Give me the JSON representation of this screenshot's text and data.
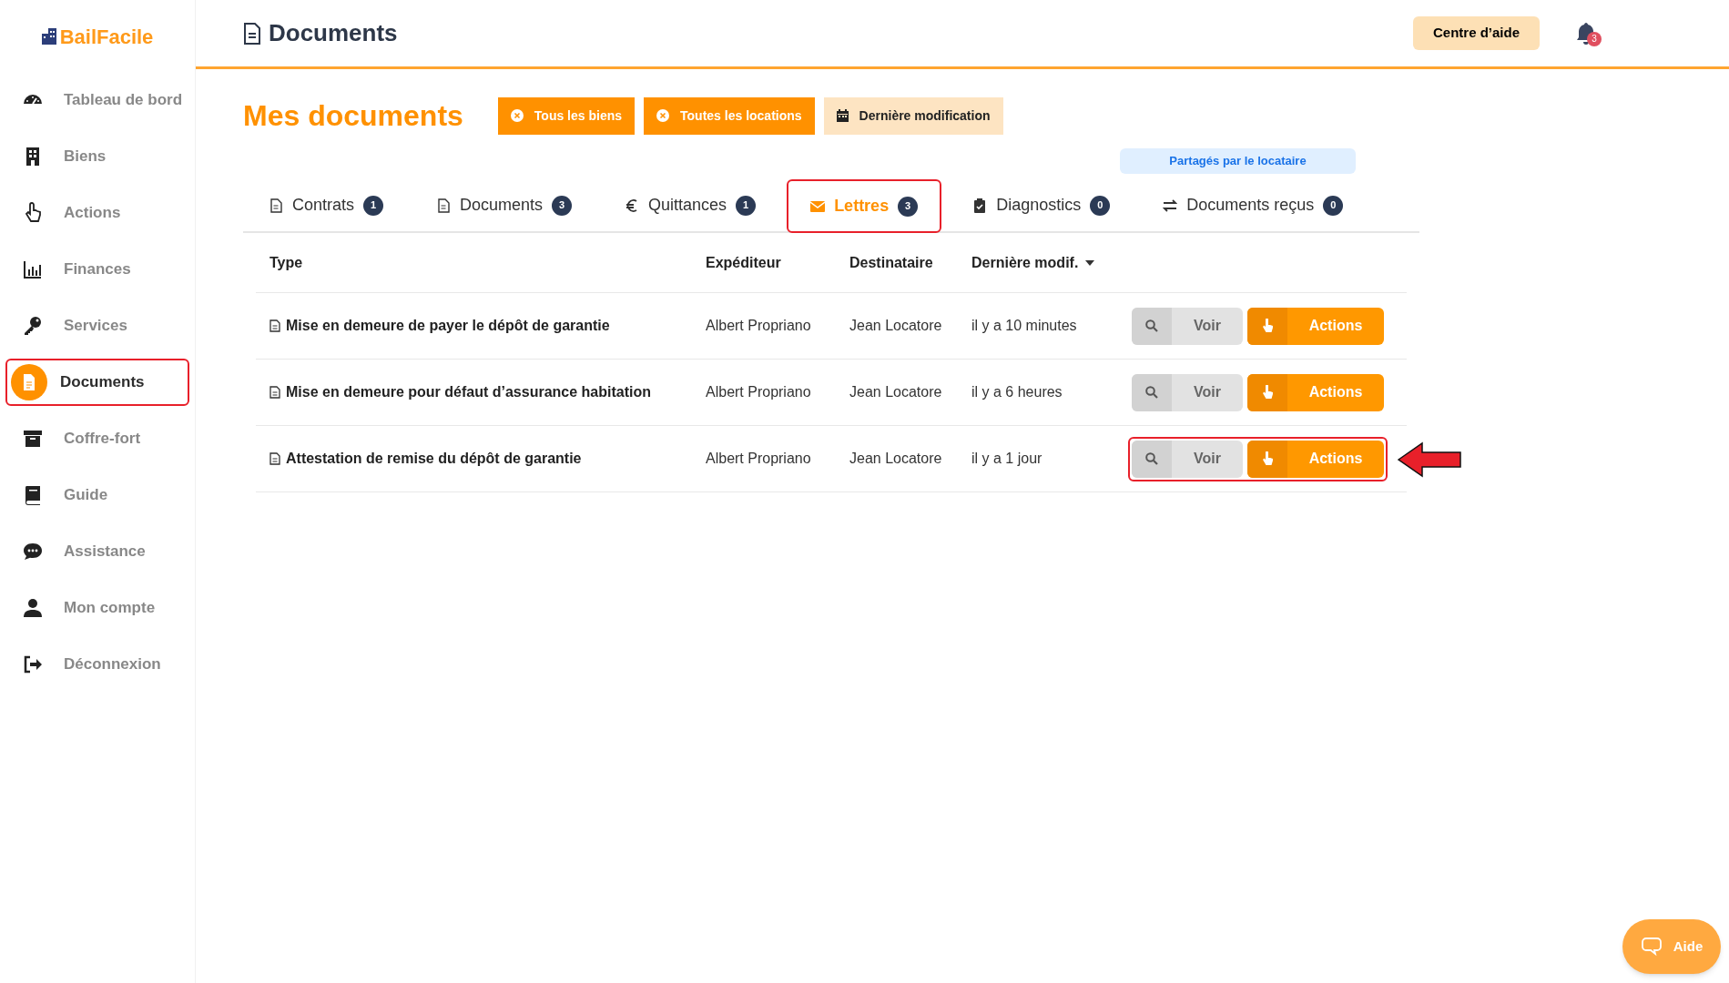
{
  "brand": {
    "name": "BailFacile"
  },
  "sidebar": {
    "items": [
      {
        "label": "Tableau de bord",
        "selected": false,
        "highlighted": false
      },
      {
        "label": "Biens",
        "selected": false,
        "highlighted": false
      },
      {
        "label": "Actions",
        "selected": false,
        "highlighted": false
      },
      {
        "label": "Finances",
        "selected": false,
        "highlighted": false
      },
      {
        "label": "Services",
        "selected": false,
        "highlighted": false
      },
      {
        "label": "Documents",
        "selected": true,
        "highlighted": true
      },
      {
        "label": "Coffre-fort",
        "selected": false,
        "highlighted": false
      },
      {
        "label": "Guide",
        "selected": false,
        "highlighted": false
      },
      {
        "label": "Assistance",
        "selected": false,
        "highlighted": false
      },
      {
        "label": "Mon compte",
        "selected": false,
        "highlighted": false
      },
      {
        "label": "Déconnexion",
        "selected": false,
        "highlighted": false
      }
    ]
  },
  "header": {
    "title": "Documents",
    "help_button": "Centre d’aide",
    "notification_count": "3"
  },
  "page": {
    "title": "Mes documents",
    "filters": [
      {
        "label": "Tous les biens",
        "kind": "clear"
      },
      {
        "label": "Toutes les locations",
        "kind": "clear"
      },
      {
        "label": "Dernière modification",
        "kind": "date"
      }
    ],
    "shared_badge": "Partagés par le locataire"
  },
  "tabs": [
    {
      "label": "Contrats",
      "count": "1",
      "selected": false,
      "highlighted": false
    },
    {
      "label": "Documents",
      "count": "3",
      "selected": false,
      "highlighted": false
    },
    {
      "label": "Quittances",
      "count": "1",
      "selected": false,
      "highlighted": false
    },
    {
      "label": "Lettres",
      "count": "3",
      "selected": true,
      "highlighted": true
    },
    {
      "label": "Diagnostics",
      "count": "0",
      "selected": false,
      "highlighted": false
    },
    {
      "label": "Documents reçus",
      "count": "0",
      "selected": false,
      "highlighted": false
    }
  ],
  "table": {
    "columns": [
      {
        "label": "Type",
        "sorted": false
      },
      {
        "label": "Expéditeur",
        "sorted": false
      },
      {
        "label": "Destinataire",
        "sorted": false
      },
      {
        "label": "Dernière modif.",
        "sorted": true
      }
    ],
    "rows": [
      {
        "type": "Mise en demeure de payer le dépôt de garantie",
        "sender": "Albert Propriano",
        "recipient": "Jean Locatore",
        "modified": "il y a 10 minutes",
        "view": "Voir",
        "actions": "Actions",
        "highlighted": false
      },
      {
        "type": "Mise en demeure pour défaut d’assurance habitation",
        "sender": "Albert Propriano",
        "recipient": "Jean Locatore",
        "modified": "il y a 6 heures",
        "view": "Voir",
        "actions": "Actions",
        "highlighted": false
      },
      {
        "type": "Attestation de remise du dépôt de garantie",
        "sender": "Albert Propriano",
        "recipient": "Jean Locatore",
        "modified": "il y a 1 jour",
        "view": "Voir",
        "actions": "Actions",
        "highlighted": true
      }
    ]
  },
  "help_widget": {
    "label": "Aide"
  }
}
